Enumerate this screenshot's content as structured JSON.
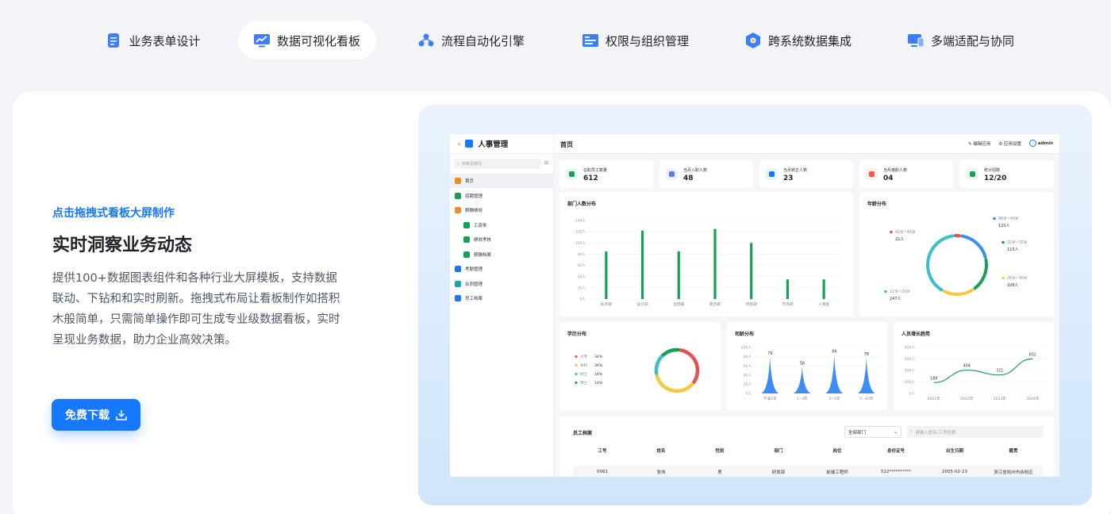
{
  "tabs": [
    {
      "label": "业务表单设计",
      "icon": "form-icon",
      "active": false
    },
    {
      "label": "数据可视化看板",
      "icon": "chart-board-icon",
      "active": true
    },
    {
      "label": "流程自动化引擎",
      "icon": "flow-icon",
      "active": false
    },
    {
      "label": "权限与组织管理",
      "icon": "org-icon",
      "active": false
    },
    {
      "label": "跨系统数据集成",
      "icon": "integration-icon",
      "active": false
    },
    {
      "label": "多端适配与协同",
      "icon": "multi-device-icon",
      "active": false
    }
  ],
  "hero": {
    "kicker": "点击拖拽式看板大屏制作",
    "headline": "实时洞察业务动态",
    "description": "提供100+数据图表组件和各种行业大屏模板，支持数据联动、下钻和和实时刷新。拖拽式布局让看板制作如搭积木般简单，只需简单操作即可生成专业级数据看板，实时呈现业务数据，助力企业高效决策。",
    "download_label": "免费下载"
  },
  "app": {
    "title": "人事管理",
    "search_placeholder": "搜索关键词",
    "menu": [
      {
        "label": "首页",
        "icon": "home-icon",
        "active": true,
        "indent": false,
        "color": "#f08a24"
      },
      {
        "label": "招聘管理",
        "icon": "recruit-icon",
        "active": false,
        "indent": false,
        "color": "#18a058"
      },
      {
        "label": "薪酬绩效",
        "icon": "salary-icon",
        "active": false,
        "indent": false,
        "color": "#f08a24"
      },
      {
        "label": "工资条",
        "icon": "payslip-icon",
        "active": false,
        "indent": true,
        "color": "#18a058"
      },
      {
        "label": "绩效考核",
        "icon": "performance-icon",
        "active": false,
        "indent": true,
        "color": "#18a058"
      },
      {
        "label": "薪酬档案",
        "icon": "salary-file-icon",
        "active": false,
        "indent": true,
        "color": "#18a058"
      },
      {
        "label": "考勤管理",
        "icon": "attendance-icon",
        "active": false,
        "indent": false,
        "color": "#1677ff"
      },
      {
        "label": "合同管理",
        "icon": "contract-icon",
        "active": false,
        "indent": false,
        "color": "#13a8a8"
      },
      {
        "label": "员工档案",
        "icon": "employee-file-icon",
        "active": false,
        "indent": false,
        "color": "#1677ff"
      }
    ],
    "breadcrumb": "首页",
    "topbar": {
      "edit": "编辑应用",
      "settings": "应用设置",
      "user": "admin"
    },
    "stats": [
      {
        "label": "在职员工数量",
        "value": "612",
        "color": "#18a058",
        "bg": "#e8f6ee"
      },
      {
        "label": "当月入职人数",
        "value": "48",
        "color": "#5b7cfa",
        "bg": "#eef1ff"
      },
      {
        "label": "当月转正人数",
        "value": "23",
        "color": "#1677ff",
        "bg": "#e8f1ff"
      },
      {
        "label": "当月离职人数",
        "value": "04",
        "color": "#f05a4a",
        "bg": "#fdeeee"
      },
      {
        "label": "统计招聘",
        "value": "12/20",
        "color": "#18a058",
        "bg": "#e8f6ee"
      }
    ],
    "panels": {
      "dept": "部门人数分布",
      "age": "年龄分布",
      "edu": "学历分布",
      "tenure": "司龄分布",
      "growth": "人员增长趋势",
      "table": "员工档案"
    },
    "table": {
      "filter": "全部部门",
      "search_placeholder": "请输入姓名/工号检索",
      "headers": [
        "工号",
        "姓名",
        "性别",
        "部门",
        "岗位",
        "身份证号",
        "出生日期",
        "籍贯"
      ],
      "rows": [
        [
          "0061",
          "张伟",
          "男",
          "研发部",
          "前端工程师",
          "522**********",
          "2005-02-23",
          "浙江省杭州市余杭区"
        ]
      ]
    }
  },
  "chart_data": [
    {
      "type": "bar",
      "title": "部门人数分布",
      "categories": [
        "技术部",
        "设计部",
        "运营部",
        "商务部",
        "项目部",
        "市场部",
        "人事部"
      ],
      "values": [
        85,
        122,
        85,
        125,
        100,
        35,
        35
      ],
      "y_ticks": [
        "0人",
        "20人",
        "40人",
        "60人",
        "80人",
        "100人",
        "120人",
        "140人"
      ],
      "ylim": [
        0,
        140
      ],
      "color": "#18a058"
    },
    {
      "type": "pie",
      "title": "年龄分布",
      "labels": [
        "36岁~40岁",
        "31岁~35岁",
        "26岁~30岁",
        "21岁~25岁",
        "41岁~45岁"
      ],
      "values": [
        120,
        115,
        108,
        247,
        22
      ],
      "value_labels": [
        "120人",
        "115人",
        "108人",
        "247人",
        "22人"
      ],
      "colors": [
        "#3d8ef0",
        "#18a058",
        "#f5c842",
        "#3bbfcf",
        "#ea4f4f"
      ]
    },
    {
      "type": "pie",
      "title": "学历分布",
      "labels": [
        "大专",
        "本科",
        "硕士",
        "博士"
      ],
      "values": [
        34,
        36,
        16,
        14
      ],
      "value_labels": [
        "34%",
        "36%",
        "16%",
        "14%"
      ],
      "colors": [
        "#ea4f4f",
        "#f5c842",
        "#3bbfcf",
        "#18a058"
      ]
    },
    {
      "type": "area",
      "title": "司龄分布",
      "categories": [
        "不满1年",
        "1~3年",
        "3~5年",
        "5~10年"
      ],
      "values": [
        79,
        58,
        84,
        78
      ],
      "y_ticks": [
        "0人",
        "20人",
        "40人",
        "60人",
        "80人",
        "100人"
      ],
      "ylim": [
        0,
        100
      ],
      "color": "#3d8ef0"
    },
    {
      "type": "line",
      "title": "人员增长趋势",
      "x": [
        "2021年",
        "2022年",
        "2023年",
        "2024年"
      ],
      "values": [
        189,
        404,
        321,
        602
      ],
      "y_ticks": [
        "0人",
        "200人",
        "400人",
        "600人",
        "800人"
      ],
      "ylim": [
        0,
        800
      ],
      "color": "#18a058"
    }
  ]
}
